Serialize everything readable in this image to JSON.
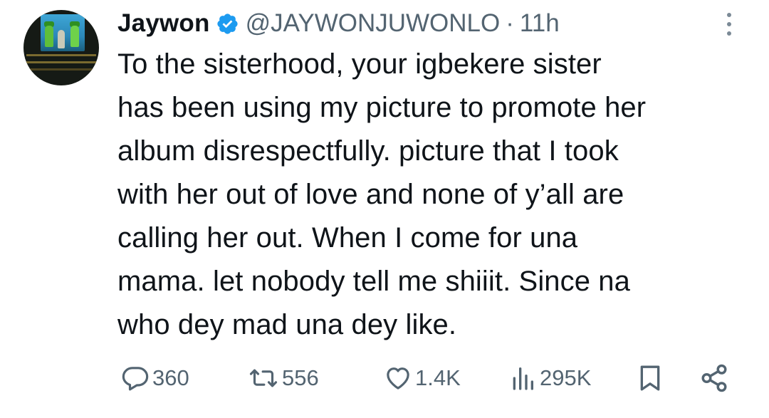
{
  "author": {
    "name": "Jaywon",
    "handle": "@JAYWONJUWONLO",
    "separator": "·",
    "time": "11h",
    "verified": true,
    "verified_color": "#1d9bf0"
  },
  "tweet": {
    "lines": [
      "To the sisterhood, your igbekere sister",
      "has been using my picture to promote her",
      "album disrespectfully. picture that I took",
      "with her out of love and none of y’all are",
      "calling her out. When I come for una",
      "mama.  let nobody tell me shiiit. Since na",
      "who dey mad una dey like."
    ]
  },
  "actions": {
    "replies": "360",
    "reposts": "556",
    "likes": "1.4K",
    "views": "295K"
  },
  "icons": {
    "verified": "verified-badge-icon",
    "more": "more-vertical-icon",
    "reply": "reply-icon",
    "repost": "repost-icon",
    "like": "heart-icon",
    "views": "views-chart-icon",
    "bookmark": "bookmark-icon",
    "share": "share-icon"
  },
  "colors": {
    "text": "#0f1419",
    "secondary": "#536471",
    "accent": "#1d9bf0"
  }
}
